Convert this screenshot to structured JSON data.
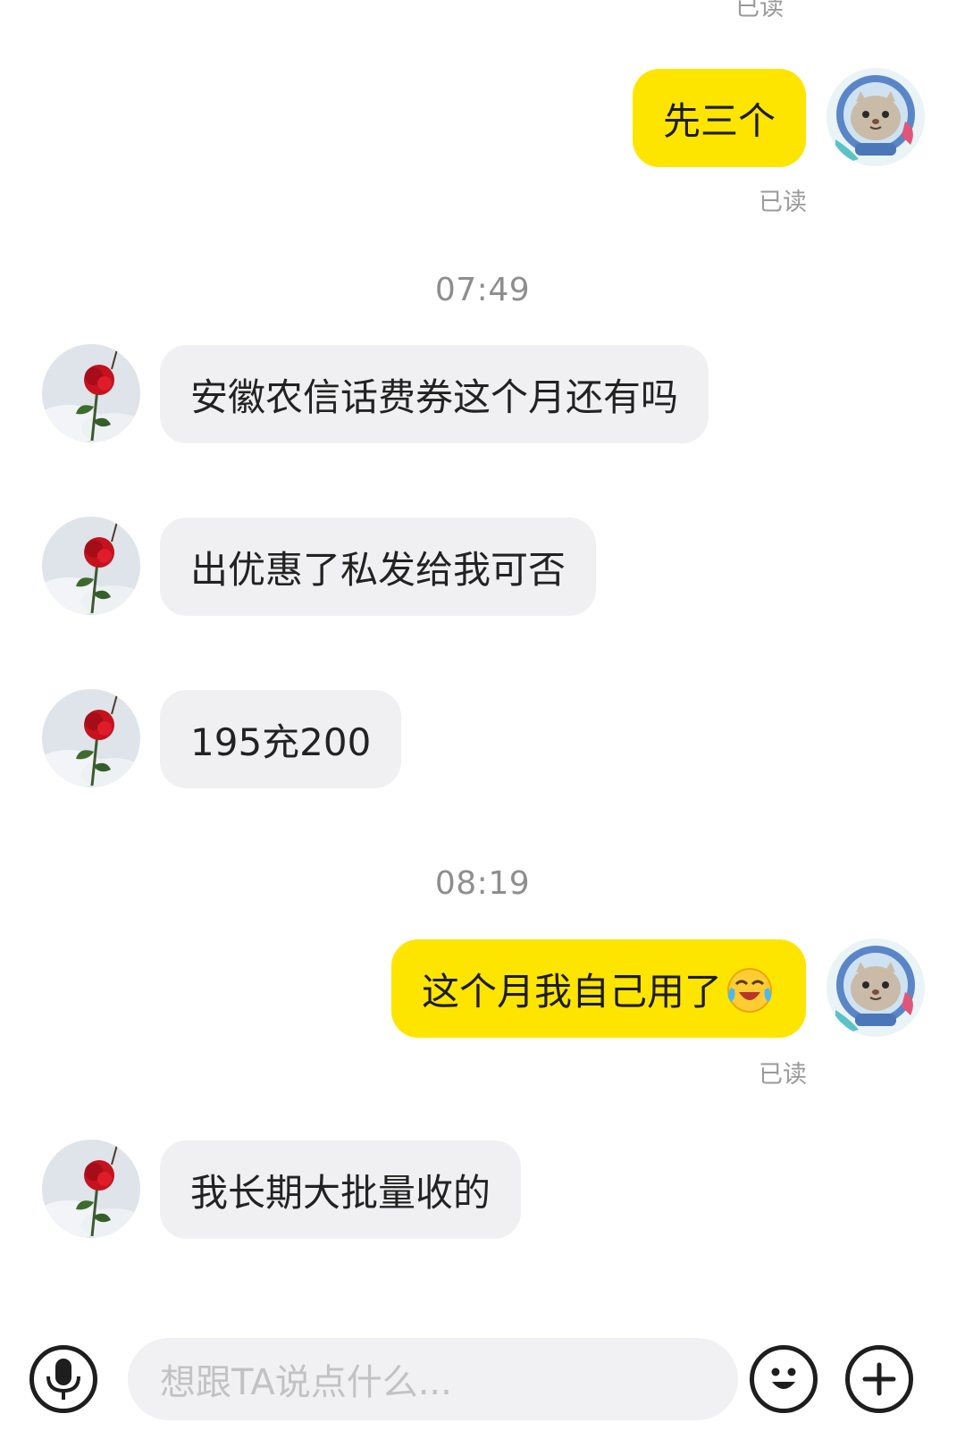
{
  "chat": {
    "top_read_receipt": "已读",
    "messages": [
      {
        "side": "out",
        "text": "先三个",
        "read": "已读"
      },
      {
        "timestamp": "07:49"
      },
      {
        "side": "in",
        "text": "安徽农信话费券这个月还有吗"
      },
      {
        "side": "in",
        "text": "出优惠了私发给我可否"
      },
      {
        "side": "in",
        "text": "195充200"
      },
      {
        "timestamp": "08:19"
      },
      {
        "side": "out",
        "text": "这个月我自己用了",
        "emoji": "crying-laughing-emoji",
        "read": "已读"
      },
      {
        "side": "in",
        "text": "我长期大批量收的"
      }
    ]
  },
  "m": {
    "0": {
      "text": "先三个",
      "read": "已读"
    },
    "ts1": "07:49",
    "1": {
      "text": "安徽农信话费券这个月还有吗"
    },
    "2": {
      "text": "出优惠了私发给我可否"
    },
    "3": {
      "text": "195充200"
    },
    "ts2": "08:19",
    "4": {
      "text": "这个月我自己用了",
      "read": "已读"
    },
    "5": {
      "text": "我长期大批量收的"
    }
  },
  "composer": {
    "placeholder": "想跟TA说点什么...",
    "icons": [
      "microphone-icon",
      "smiley-icon",
      "plus-icon"
    ]
  },
  "colors": {
    "outgoing_bubble": "#fee500",
    "incoming_bubble": "#f0f0f2",
    "timestamp_text": "#8e8e8e",
    "read_text": "#9a9a9a",
    "placeholder_text": "#c2c2c4"
  }
}
